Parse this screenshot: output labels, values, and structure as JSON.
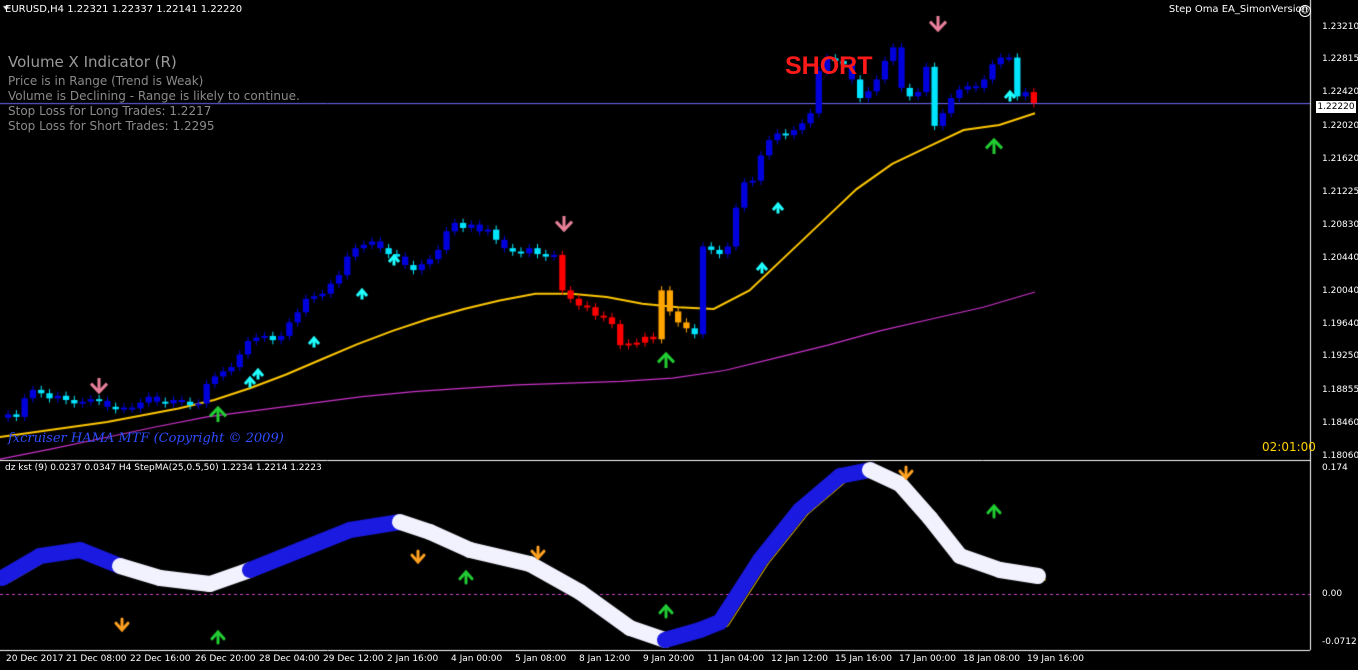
{
  "header": {
    "symbol_info": "EURUSD,H4  1.22321 1.22337 1.22141 1.22220",
    "ea_name": "Step Oma EA_SimonVersion",
    "ea_icon": "smiley-icon"
  },
  "volume_panel": {
    "title": "Volume X Indicator (R)",
    "lines": [
      "Price is in Range (Trend is Weak)",
      "Volume is Declining - Range is likely to continue.",
      "Stop Loss for Long Trades: 1.2217",
      "Stop Loss for Short Trades: 1.2295"
    ]
  },
  "signal_text": "SHORT",
  "copyright": "fxcruiser HAMA MTF (Copyright © 2009)",
  "timer": "02:01:00",
  "price_axis": {
    "labels": [
      "1.23210",
      "1.22815",
      "1.22420",
      "1.22020",
      "1.21620",
      "1.21225",
      "1.20830",
      "1.20440",
      "1.20040",
      "1.19640",
      "1.19250",
      "1.18855",
      "1.18460",
      "1.18060"
    ],
    "current": "1.22220"
  },
  "subwindow": {
    "label": "dz kst (9) 0.0237 0.0347  H4 StepMA(25,0.5,50) 1.2234 1.2214 1.2223",
    "axis_labels": [
      "0.174",
      "0.00",
      "-0.0712"
    ]
  },
  "time_axis": [
    "20 Dec 2017",
    "21 Dec 08:00",
    "22 Dec 16:00",
    "26 Dec 20:00",
    "28 Dec 04:00",
    "29 Dec 12:00",
    "2 Jan 16:00",
    "4 Jan 00:00",
    "5 Jan 08:00",
    "8 Jan 12:00",
    "9 Jan 20:00",
    "11 Jan 04:00",
    "12 Jan 12:00",
    "15 Jan 16:00",
    "17 Jan 00:00",
    "18 Jan 08:00",
    "19 Jan 16:00"
  ],
  "colors": {
    "bull_strong": "#0000dd",
    "bull_weak": "#00e5ff",
    "bear": "#ff0000",
    "neutral": "#ffa500",
    "ma_fast": "#ffc800",
    "ma_slow": "#cc33cc",
    "grid_line": "#6e6eff"
  },
  "chart_data": {
    "type": "candlestick",
    "price_range": [
      1.1806,
      1.233
    ],
    "current_price": 1.2222,
    "closes": [
      1.1853,
      1.185,
      1.1872,
      1.1882,
      1.1878,
      1.1872,
      1.1875,
      1.187,
      1.1866,
      1.1868,
      1.1871,
      1.1869,
      1.1862,
      1.1859,
      1.1861,
      1.186,
      1.1867,
      1.1874,
      1.1868,
      1.1866,
      1.187,
      1.1868,
      1.1864,
      1.1866,
      1.1889,
      1.1898,
      1.1904,
      1.1909,
      1.1924,
      1.194,
      1.1944,
      1.1946,
      1.1941,
      1.1946,
      1.1962,
      1.1974,
      1.199,
      1.1993,
      1.1996,
      1.2008,
      1.2018,
      1.204,
      1.205,
      1.2054,
      1.2058,
      1.205,
      1.2043,
      1.204,
      1.203,
      1.2024,
      1.2031,
      1.2037,
      1.2048,
      1.207,
      1.208,
      1.2074,
      1.2078,
      1.207,
      1.2072,
      1.206,
      1.205,
      1.2046,
      1.2044,
      1.205,
      1.2043,
      1.204,
      1.2042,
      1.2,
      1.199,
      1.1982,
      1.198,
      1.197,
      1.1968,
      1.196,
      1.1935,
      1.1937,
      1.1938,
      1.1945,
      1.1942,
      1.2,
      1.1975,
      1.1962,
      1.1955,
      1.1948,
      1.2052,
      1.2048,
      1.2043,
      1.2052,
      1.2098,
      1.2128,
      1.213,
      1.216,
      1.2178,
      1.2186,
      1.2184,
      1.219,
      1.2198,
      1.221,
      1.226,
      1.2275,
      1.2272,
      1.2268,
      1.225,
      1.2228,
      1.2236,
      1.225,
      1.2272,
      1.2288,
      1.224,
      1.223,
      1.2235,
      1.2265,
      1.2195,
      1.221,
      1.2228,
      1.2238,
      1.2242,
      1.224,
      1.225,
      1.2268,
      1.2276,
      1.2276,
      1.223,
      1.2235,
      1.2222
    ],
    "ma_fast": [
      1.1826,
      1.1832,
      1.1838,
      1.1844,
      1.1852,
      1.186,
      1.187,
      1.1884,
      1.19,
      1.1918,
      1.1936,
      1.1952,
      1.1966,
      1.1978,
      1.1988,
      1.1996,
      1.1996,
      1.1992,
      1.1984,
      1.198,
      1.1978,
      1.2,
      1.204,
      1.208,
      1.212,
      1.215,
      1.217,
      1.219,
      1.2196,
      1.221
    ],
    "ma_slow": [
      1.18,
      1.1812,
      1.1825,
      1.1838,
      1.185,
      1.1858,
      1.1866,
      1.1874,
      1.188,
      1.1884,
      1.1888,
      1.189,
      1.1892,
      1.1896,
      1.1905,
      1.192,
      1.1935,
      1.1952,
      1.1966,
      1.198,
      1.1998
    ]
  }
}
